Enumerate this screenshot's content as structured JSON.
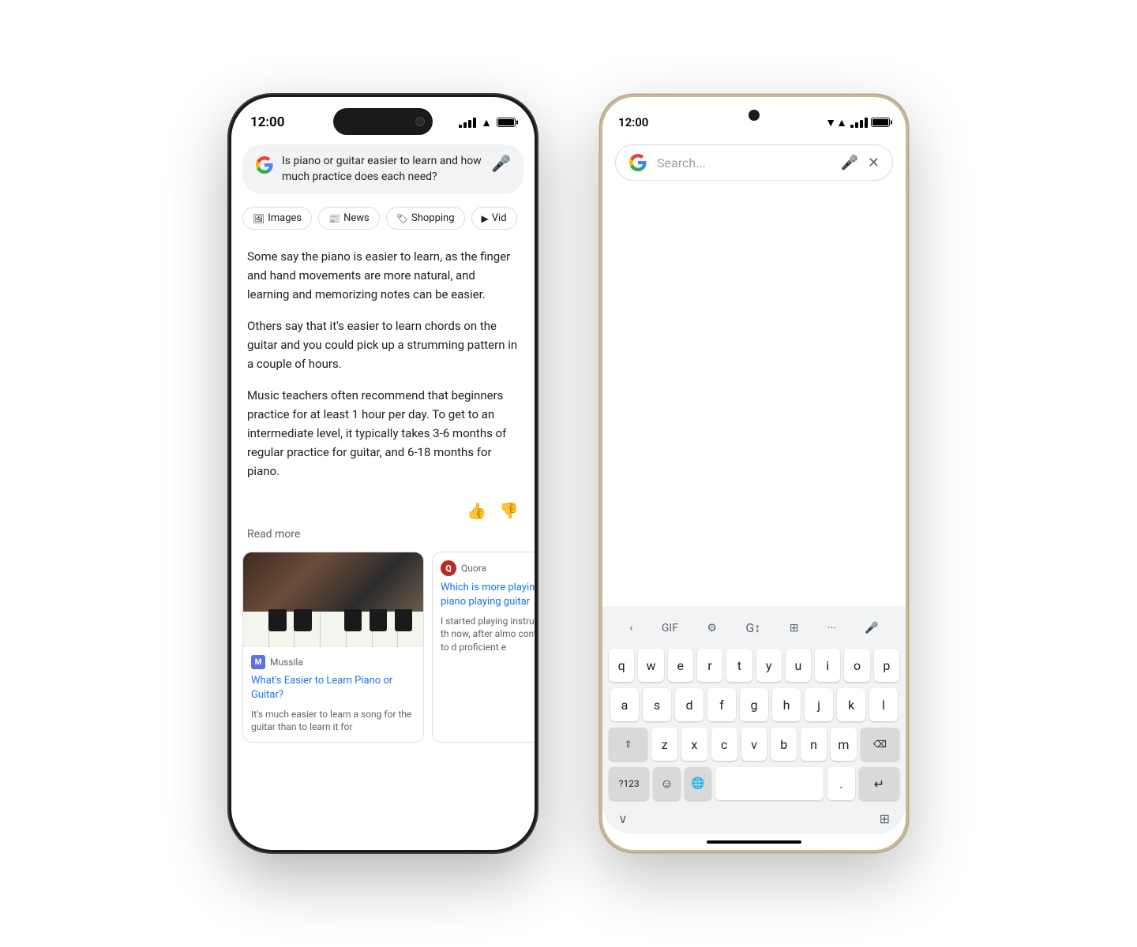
{
  "iphone": {
    "time": "12:00",
    "search_query": "Is piano or guitar easier to learn and how much practice does each need?",
    "tabs": [
      {
        "label": "Images",
        "icon": "🖼"
      },
      {
        "label": "News",
        "icon": "📰"
      },
      {
        "label": "Shopping",
        "icon": "🏷"
      },
      {
        "label": "Vid",
        "icon": "▶"
      }
    ],
    "result_paragraphs": [
      "Some say the piano is easier to learn, as the finger and hand movements are more natural, and learning and memorizing notes can be easier.",
      "Others say that it's easier to learn chords on the guitar and you could pick up a strumming pattern in a couple of hours.",
      "Music teachers often recommend that beginners practice for at least 1 hour per day. To get to an intermediate level, it typically takes 3-6 months of regular practice for guitar, and 6-18 months for piano."
    ],
    "read_more": "Read more",
    "articles": [
      {
        "source": "Mussila",
        "source_icon": "M",
        "title": "What's Easier to Learn Piano or Guitar?",
        "snippet": "It's much easier to learn a song for the guitar than to learn it for"
      },
      {
        "source": "Quora",
        "source_icon": "Q",
        "title": "Which is more playing piano playing guitar",
        "snippet": "I started playing instruments th now, after almo continue to d proficient e"
      }
    ]
  },
  "android": {
    "time": "12:00",
    "search_placeholder": "Search...",
    "keyboard": {
      "toolbar": [
        "←",
        "GIF",
        "⚙",
        "🔄",
        "⊞",
        "...",
        "🎤"
      ],
      "rows": [
        [
          "q",
          "w",
          "e",
          "r",
          "t",
          "y",
          "u",
          "i",
          "o",
          "p"
        ],
        [
          "a",
          "s",
          "d",
          "f",
          "g",
          "h",
          "j",
          "k",
          "l"
        ],
        [
          "⇧",
          "z",
          "x",
          "c",
          "v",
          "b",
          "n",
          "m",
          "⌫"
        ],
        [
          "?123",
          "☺",
          "🌐",
          " ",
          ".",
          "↵"
        ]
      ]
    }
  }
}
